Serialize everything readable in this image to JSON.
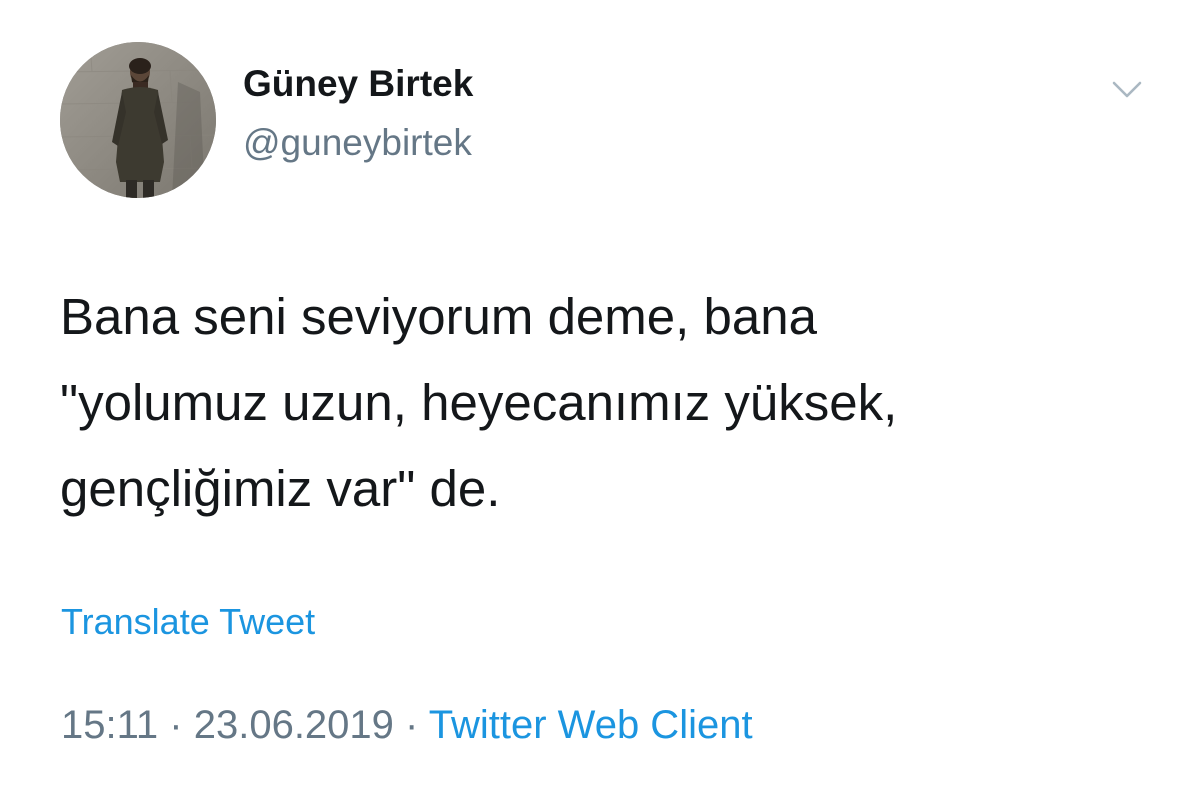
{
  "author": {
    "display_name": "Güney Birtek",
    "handle": "@guneybirtek",
    "avatar_icon": "profile-photo"
  },
  "tweet": {
    "lines": [
      "Bana seni seviyorum deme, bana",
      "\"yolumuz uzun, heyecanımız yüksek,",
      "gençliğimiz var\" de."
    ],
    "translate_label": "Translate Tweet",
    "time": "15:11",
    "separator": "·",
    "date": "23.06.2019",
    "client": "Twitter Web Client"
  },
  "menu": {
    "caret_icon": "chevron-down-icon"
  },
  "colors": {
    "text": "#14171a",
    "secondary": "#657786",
    "link": "#1b95e0",
    "caret": "#aab8c2"
  }
}
